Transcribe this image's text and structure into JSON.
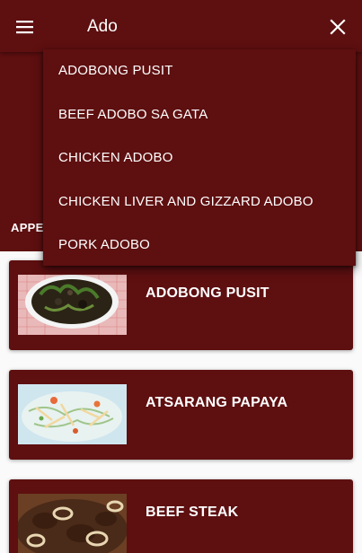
{
  "search": {
    "query": "Ado"
  },
  "tabs": {
    "visible_label": "APPETIZER"
  },
  "suggestions": [
    {
      "label": "ADOBONG PUSIT"
    },
    {
      "label": "BEEF ADOBO SA GATA"
    },
    {
      "label": "CHICKEN ADOBO"
    },
    {
      "label": "CHICKEN LIVER AND GIZZARD ADOBO"
    },
    {
      "label": "PORK ADOBO"
    }
  ],
  "recipes": [
    {
      "title": "ADOBONG PUSIT"
    },
    {
      "title": "ATSARANG PAPAYA"
    },
    {
      "title": "BEEF STEAK"
    }
  ],
  "icons": {
    "menu": "hamburger-menu-icon",
    "close": "close-icon"
  },
  "colors": {
    "primary": "#5e0f10",
    "background": "#fafafa",
    "text": "#ffffff"
  }
}
